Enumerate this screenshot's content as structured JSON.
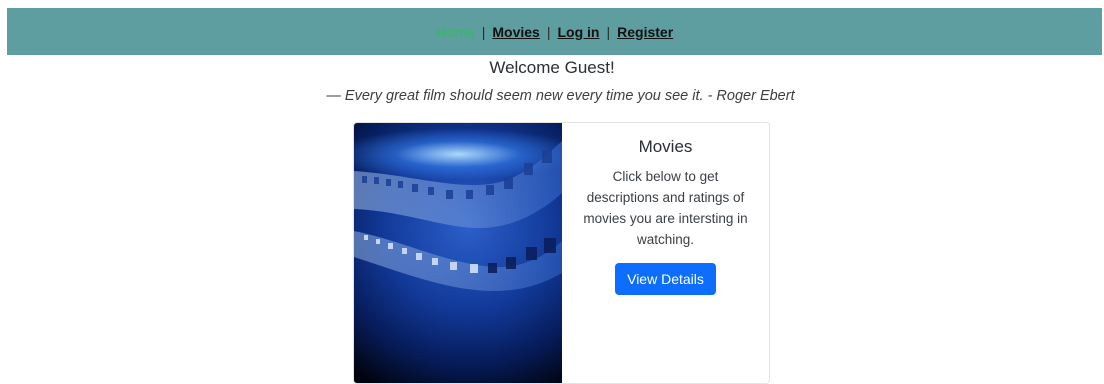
{
  "nav": {
    "items": [
      {
        "label": "Home"
      },
      {
        "label": "Movies"
      },
      {
        "label": "Log in"
      },
      {
        "label": "Register"
      }
    ],
    "separator": "|"
  },
  "welcome": "Welcome Guest!",
  "quote": "— Every great film should seem new every time you see it. - Roger Ebert",
  "card": {
    "title": "Movies",
    "text": "Click below to get descriptions and ratings of movies you are intersting in watching.",
    "button_label": "View Details"
  },
  "colors": {
    "nav_bg": "#5f9ea0",
    "nav_active": "#3cb371",
    "button_bg": "#0d6efd"
  }
}
